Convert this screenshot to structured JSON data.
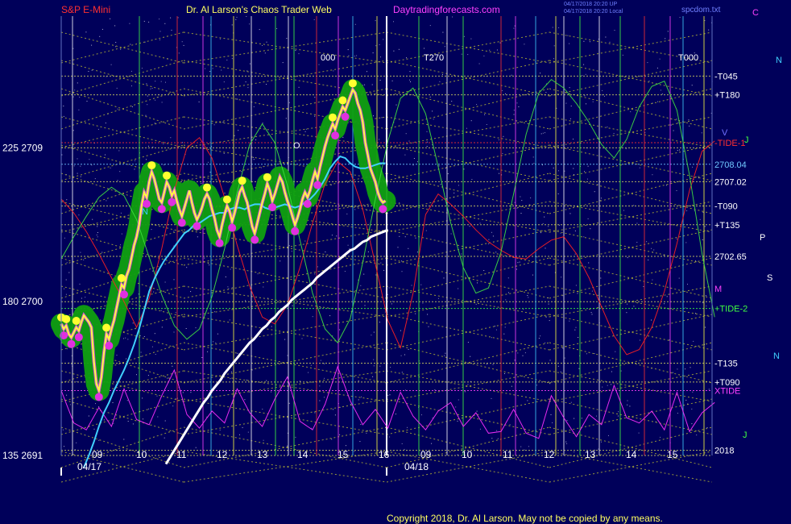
{
  "header": {
    "left": "S&P E-Mini",
    "center": "Dr. Al Larson's Chaos Trader Web",
    "site": "Daytradingforecasts.com",
    "stamp1": "04/17/2018 20:20 UP",
    "stamp2": "04/17/2018 20:20 Local",
    "file": "spcdom.txt",
    "corner": "C"
  },
  "footer": {
    "copyright": "Copyright 2018, Dr. Al Larson. May not be copied by any means."
  },
  "chart_data": {
    "type": "line",
    "ylim": [
      2691,
      2716
    ],
    "left_axis": [
      {
        "angle": "225",
        "price": "2709",
        "value": 2709
      },
      {
        "angle": "180",
        "price": "2700",
        "value": 2700
      },
      {
        "angle": "135",
        "price": "2691",
        "value": 2691
      }
    ],
    "x_ticks": [
      "09",
      "10",
      "11",
      "12",
      "13",
      "14",
      "15",
      "16",
      "09",
      "10",
      "11",
      "12",
      "13",
      "14",
      "15"
    ],
    "x_dates": [
      "04/17",
      "04/18"
    ],
    "right_labels": [
      {
        "text": "-T045",
        "value": 2713.2,
        "color": "#ffffff"
      },
      {
        "text": "+T180",
        "value": 2712.1,
        "color": "#ffffff"
      },
      {
        "text": "-TIDE-1",
        "value": 2709.3,
        "color": "#ff3030"
      },
      {
        "text": "2708.04",
        "value": 2708.04,
        "color": "#70c8ff"
      },
      {
        "text": "2707.02",
        "value": 2707.02,
        "color": "#ffffff"
      },
      {
        "text": "-T090",
        "value": 2705.6,
        "color": "#ffffff"
      },
      {
        "text": "+T135",
        "value": 2704.5,
        "color": "#ffffff"
      },
      {
        "text": "2702.65",
        "value": 2702.65,
        "color": "#ffffff"
      },
      {
        "text": "+TIDE-2",
        "value": 2699.6,
        "color": "#40ff40"
      },
      {
        "text": "-T135",
        "value": 2696.4,
        "color": "#ffffff"
      },
      {
        "text": "+T090",
        "value": 2695.3,
        "color": "#ffffff"
      },
      {
        "text": "XTIDE",
        "value": 2694.8,
        "color": "#ff40ff"
      },
      {
        "text": "2018",
        "value": 2691.3,
        "color": "#ffffff"
      }
    ],
    "top_markers": [
      "000",
      "T270",
      "T000"
    ],
    "planet_labels": [
      "N",
      "N",
      "J",
      "O",
      "P",
      "M",
      "S",
      "N",
      "V",
      "J"
    ],
    "series": [
      {
        "color": "#ffff40",
        "x": [
          0.0,
          0.3,
          0.6,
          0.9,
          1.2,
          1.5,
          1.8,
          2.1,
          2.4,
          2.7,
          3.0,
          3.3,
          3.6,
          3.9,
          4.2,
          4.5,
          4.8,
          5.1,
          5.4,
          5.7,
          6.0,
          6.3,
          6.6,
          6.9,
          7.2,
          7.5,
          7.8,
          8.1,
          8.4,
          8.7,
          9.0,
          9.3,
          9.6,
          9.9,
          10.2,
          10.5,
          10.8,
          11.1,
          11.4,
          11.7,
          12.0,
          12.3,
          12.6,
          12.9,
          13.2,
          13.5,
          13.8,
          14.1,
          14.4,
          14.7,
          15.0,
          15.3,
          15.6,
          15.9,
          16.2,
          16.5,
          16.8,
          17.1,
          17.4,
          17.7,
          18.0,
          18.3,
          18.6,
          18.9,
          19.2,
          19.5,
          19.8,
          20.1,
          20.4,
          20.7,
          21.0,
          21.3,
          21.6,
          21.9,
          22.2,
          22.5,
          22.8,
          23.1,
          23.4,
          23.7,
          24.0,
          24.3,
          24.6,
          24.9,
          25.2,
          25.5,
          25.8,
          26.1,
          26.4,
          26.7,
          27.0,
          27.3,
          27.6,
          27.9,
          28.2,
          28.5,
          28.8,
          29.1,
          29.4,
          29.7,
          30.0,
          30.3,
          30.6,
          30.9,
          31.2,
          31.5,
          31.8,
          32.1,
          32.4,
          32.7,
          33.0,
          33.3,
          33.6,
          33.9,
          34.2,
          34.5,
          34.8,
          35.1,
          35.4,
          35.7,
          36.0,
          36.3,
          36.6,
          36.9,
          37.2,
          37.5,
          37.8,
          38.1,
          38.4,
          38.7
        ],
        "y": [
          2698.7,
          2698.4,
          2698.6,
          2698.1,
          2697.9,
          2698.2,
          2698.5,
          2698.3,
          2698.8,
          2699.2,
          2699.0,
          2698.8,
          2698.5,
          2696.5,
          2695.2,
          2694.8,
          2695.6,
          2697.0,
          2698.1,
          2697.8,
          2698.4,
          2698.9,
          2699.6,
          2700.3,
          2701.0,
          2700.8,
          2701.5,
          2701.9,
          2702.6,
          2703.3,
          2703.8,
          2704.5,
          2705.6,
          2706.4,
          2706.1,
          2707.0,
          2707.6,
          2707.2,
          2706.6,
          2706.0,
          2705.8,
          2706.4,
          2707.0,
          2706.7,
          2706.2,
          2706.5,
          2705.9,
          2705.4,
          2705.0,
          2705.5,
          2706.0,
          2706.5,
          2705.8,
          2705.2,
          2704.8,
          2705.1,
          2705.5,
          2706.0,
          2706.3,
          2706.0,
          2705.4,
          2704.9,
          2704.2,
          2703.8,
          2704.5,
          2705.1,
          2705.6,
          2705.3,
          2704.7,
          2705.2,
          2705.8,
          2706.4,
          2706.7,
          2706.2,
          2705.8,
          2705.1,
          2704.4,
          2704.0,
          2704.6,
          2705.2,
          2705.8,
          2706.3,
          2706.9,
          2706.5,
          2705.9,
          2706.3,
          2706.8,
          2707.3,
          2707.0,
          2706.4,
          2705.9,
          2705.5,
          2705.0,
          2704.5,
          2704.9,
          2705.4,
          2706.0,
          2706.4,
          2706.1,
          2706.5,
          2707.1,
          2707.6,
          2707.2,
          2707.9,
          2708.5,
          2709.1,
          2709.6,
          2710.0,
          2710.4,
          2710.1,
          2710.6,
          2711.0,
          2711.4,
          2711.2,
          2711.6,
          2712.0,
          2712.4,
          2712.2,
          2711.6,
          2711.2,
          2710.5,
          2709.3,
          2708.6,
          2707.8,
          2707.4,
          2707.0,
          2706.4,
          2706.0,
          2705.8,
          2705.9
        ]
      },
      {
        "color": "#40d0ff",
        "x": [
          2.7,
          3.3,
          3.9,
          4.5,
          5.1,
          5.7,
          6.3,
          6.9,
          7.5,
          8.1,
          8.7,
          9.3,
          9.9,
          10.5,
          11.1,
          11.7,
          12.3,
          12.9,
          13.5,
          14.1,
          14.7,
          15.3,
          15.9,
          16.5,
          17.1,
          17.7,
          18.3,
          18.9,
          19.5,
          20.1,
          20.7,
          21.3,
          21.9,
          22.5,
          23.1,
          23.7,
          24.3,
          24.9,
          25.5,
          26.1,
          26.7,
          27.3,
          27.9,
          28.5,
          29.1,
          29.7,
          30.3,
          30.9,
          31.5,
          32.1,
          32.7,
          33.3,
          33.9,
          34.5,
          35.1,
          35.7,
          36.3,
          36.9,
          37.5,
          38.1,
          38.7
        ],
        "y": [
          2690.3,
          2691.0,
          2691.8,
          2692.7,
          2693.5,
          2694.1,
          2694.8,
          2695.4,
          2696.0,
          2696.7,
          2697.5,
          2698.4,
          2699.5,
          2700.6,
          2701.3,
          2701.9,
          2702.4,
          2702.8,
          2703.2,
          2703.6,
          2704.0,
          2704.2,
          2704.5,
          2704.6,
          2704.8,
          2705.0,
          2705.1,
          2705.2,
          2705.2,
          2705.4,
          2705.5,
          2705.5,
          2705.4,
          2705.6,
          2705.7,
          2705.7,
          2705.5,
          2705.4,
          2705.5,
          2705.6,
          2705.7,
          2705.6,
          2705.5,
          2705.6,
          2705.8,
          2706.0,
          2706.3,
          2706.7,
          2707.2,
          2707.8,
          2708.2,
          2708.5,
          2708.4,
          2708.1,
          2707.9,
          2707.8,
          2707.8,
          2707.9,
          2708.0,
          2708.1,
          2708.1
        ]
      },
      {
        "color": "#ffffff",
        "x": [
          12.5,
          13.0,
          13.5,
          14.0,
          14.5,
          15.0,
          15.5,
          16.0,
          16.5,
          17.0,
          17.5,
          18.0,
          18.5,
          19.0,
          19.5,
          20.0,
          20.5,
          21.0,
          21.5,
          22.0,
          22.5,
          23.0,
          23.5,
          24.0,
          24.5,
          25.0,
          25.5,
          26.0,
          26.5,
          27.0,
          27.5,
          28.0,
          28.5,
          29.0,
          29.5,
          30.0,
          30.5,
          31.0,
          31.5,
          32.0,
          32.5,
          33.0,
          33.5,
          34.0,
          34.5,
          35.0,
          35.5,
          36.0,
          36.5,
          37.0,
          37.5,
          38.0,
          38.5,
          39.0
        ],
        "y": [
          2690.5,
          2690.9,
          2691.3,
          2691.7,
          2692.1,
          2692.5,
          2692.9,
          2693.3,
          2693.7,
          2694.1,
          2694.4,
          2694.8,
          2695.1,
          2695.4,
          2695.8,
          2696.1,
          2696.4,
          2696.7,
          2697.0,
          2697.3,
          2697.6,
          2697.8,
          2698.1,
          2698.4,
          2698.6,
          2698.9,
          2699.1,
          2699.4,
          2699.6,
          2699.8,
          2700.1,
          2700.3,
          2700.5,
          2700.7,
          2700.9,
          2701.1,
          2701.4,
          2701.6,
          2701.8,
          2702.0,
          2702.2,
          2702.4,
          2702.6,
          2702.8,
          2703.0,
          2703.1,
          2703.3,
          2703.5,
          2703.6,
          2703.8,
          2703.9,
          2704.0,
          2704.1,
          2704.2
        ]
      },
      {
        "color": "#ff2020",
        "x": [
          0.0,
          1.5,
          3.0,
          4.5,
          6.0,
          7.5,
          9.0,
          10.5,
          12.0,
          13.5,
          15.0,
          16.5,
          18.0,
          19.5,
          21.0,
          22.5,
          24.0,
          25.5,
          27.0,
          28.5,
          30.0,
          31.5,
          33.0,
          34.5,
          36.0,
          37.5,
          39.0,
          40.5,
          42.0,
          43.5,
          45.0,
          46.5,
          48.0,
          49.5,
          51.0,
          52.5,
          54.0,
          55.5,
          57.0,
          58.5,
          60.0,
          61.5,
          63.0,
          64.5,
          66.0,
          67.5,
          69.0,
          70.5,
          72.0,
          73.5,
          75.0,
          76.5,
          78.0
        ],
        "y": [
          2706.0,
          2705.2,
          2704.1,
          2702.8,
          2701.4,
          2700.0,
          2698.5,
          2700.2,
          2703.1,
          2706.5,
          2709.0,
          2709.6,
          2708.4,
          2706.1,
          2703.3,
          2700.9,
          2699.1,
          2698.7,
          2699.8,
          2702.0,
          2704.6,
          2706.9,
          2708.2,
          2707.6,
          2705.4,
          2702.2,
          2698.9,
          2697.3,
          2700.5,
          2705.1,
          2706.3,
          2705.7,
          2705.0,
          2704.2,
          2703.5,
          2703.0,
          2702.6,
          2702.5,
          2703.1,
          2703.6,
          2703.8,
          2702.8,
          2701.4,
          2699.7,
          2698.0,
          2696.9,
          2697.2,
          2698.5,
          2700.6,
          2703.4,
          2706.5,
          2708.8,
          2709.4
        ]
      },
      {
        "color": "#40e040",
        "x": [
          0.0,
          1.5,
          3.0,
          4.5,
          6.0,
          7.5,
          9.0,
          10.5,
          12.0,
          13.5,
          15.0,
          16.5,
          18.0,
          19.5,
          21.0,
          22.5,
          24.0,
          25.5,
          27.0,
          28.5,
          30.0,
          31.5,
          33.0,
          34.5,
          36.0,
          37.5,
          39.0,
          40.5,
          42.0,
          43.5,
          45.0,
          46.5,
          48.0,
          49.5,
          51.0,
          52.5,
          54.0,
          55.5,
          57.0,
          58.5,
          60.0,
          61.5,
          63.0,
          64.5,
          66.0,
          67.5,
          69.0,
          70.5,
          72.0,
          73.5,
          75.0,
          76.5,
          78.0
        ],
        "y": [
          2702.5,
          2703.8,
          2705.0,
          2706.1,
          2706.7,
          2706.2,
          2704.8,
          2702.6,
          2700.4,
          2698.6,
          2697.8,
          2698.4,
          2700.3,
          2703.1,
          2706.4,
          2709.2,
          2710.4,
          2709.3,
          2706.8,
          2703.6,
          2700.5,
          2698.4,
          2697.6,
          2699.0,
          2702.3,
          2706.0,
          2709.4,
          2711.9,
          2712.5,
          2711.0,
          2707.9,
          2704.6,
          2702.0,
          2700.5,
          2700.8,
          2702.9,
          2706.3,
          2709.8,
          2712.2,
          2713.0,
          2712.5,
          2711.6,
          2710.5,
          2709.2,
          2708.4,
          2709.5,
          2711.4,
          2712.6,
          2712.9,
          2711.2,
          2707.4,
          2702.8,
          2699.1
        ]
      },
      {
        "color": "#ff30ff",
        "x": [
          0.0,
          1.5,
          3.0,
          4.5,
          6.0,
          7.5,
          9.0,
          10.5,
          12.0,
          13.5,
          15.0,
          16.5,
          18.0,
          19.5,
          21.0,
          22.5,
          24.0,
          25.5,
          27.0,
          28.5,
          30.0,
          31.5,
          33.0,
          34.5,
          36.0,
          37.5,
          39.0,
          40.5,
          42.0,
          43.5,
          45.0,
          46.5,
          48.0,
          49.5,
          51.0,
          52.5,
          54.0,
          55.5,
          57.0,
          58.5,
          60.0,
          61.5,
          63.0,
          64.5,
          66.0,
          67.5,
          69.0,
          70.5,
          72.0,
          73.5,
          75.0,
          76.5,
          78.0
        ],
        "y": [
          2694.8,
          2692.9,
          2692.5,
          2693.8,
          2692.7,
          2694.9,
          2693.1,
          2692.8,
          2694.5,
          2696.0,
          2693.4,
          2692.6,
          2693.6,
          2692.9,
          2694.9,
          2693.5,
          2692.7,
          2694.3,
          2695.6,
          2693.0,
          2692.5,
          2694.0,
          2696.2,
          2694.2,
          2692.8,
          2693.7,
          2692.6,
          2694.7,
          2693.3,
          2692.5,
          2693.6,
          2694.1,
          2692.7,
          2693.5,
          2692.3,
          2692.4,
          2693.7,
          2692.3,
          2692.0,
          2694.5,
          2693.2,
          2692.1,
          2693.4,
          2692.8,
          2695.1,
          2693.2,
          2692.9,
          2693.6,
          2692.5,
          2694.7,
          2692.4,
          2693.5,
          2694.1
        ]
      }
    ]
  }
}
